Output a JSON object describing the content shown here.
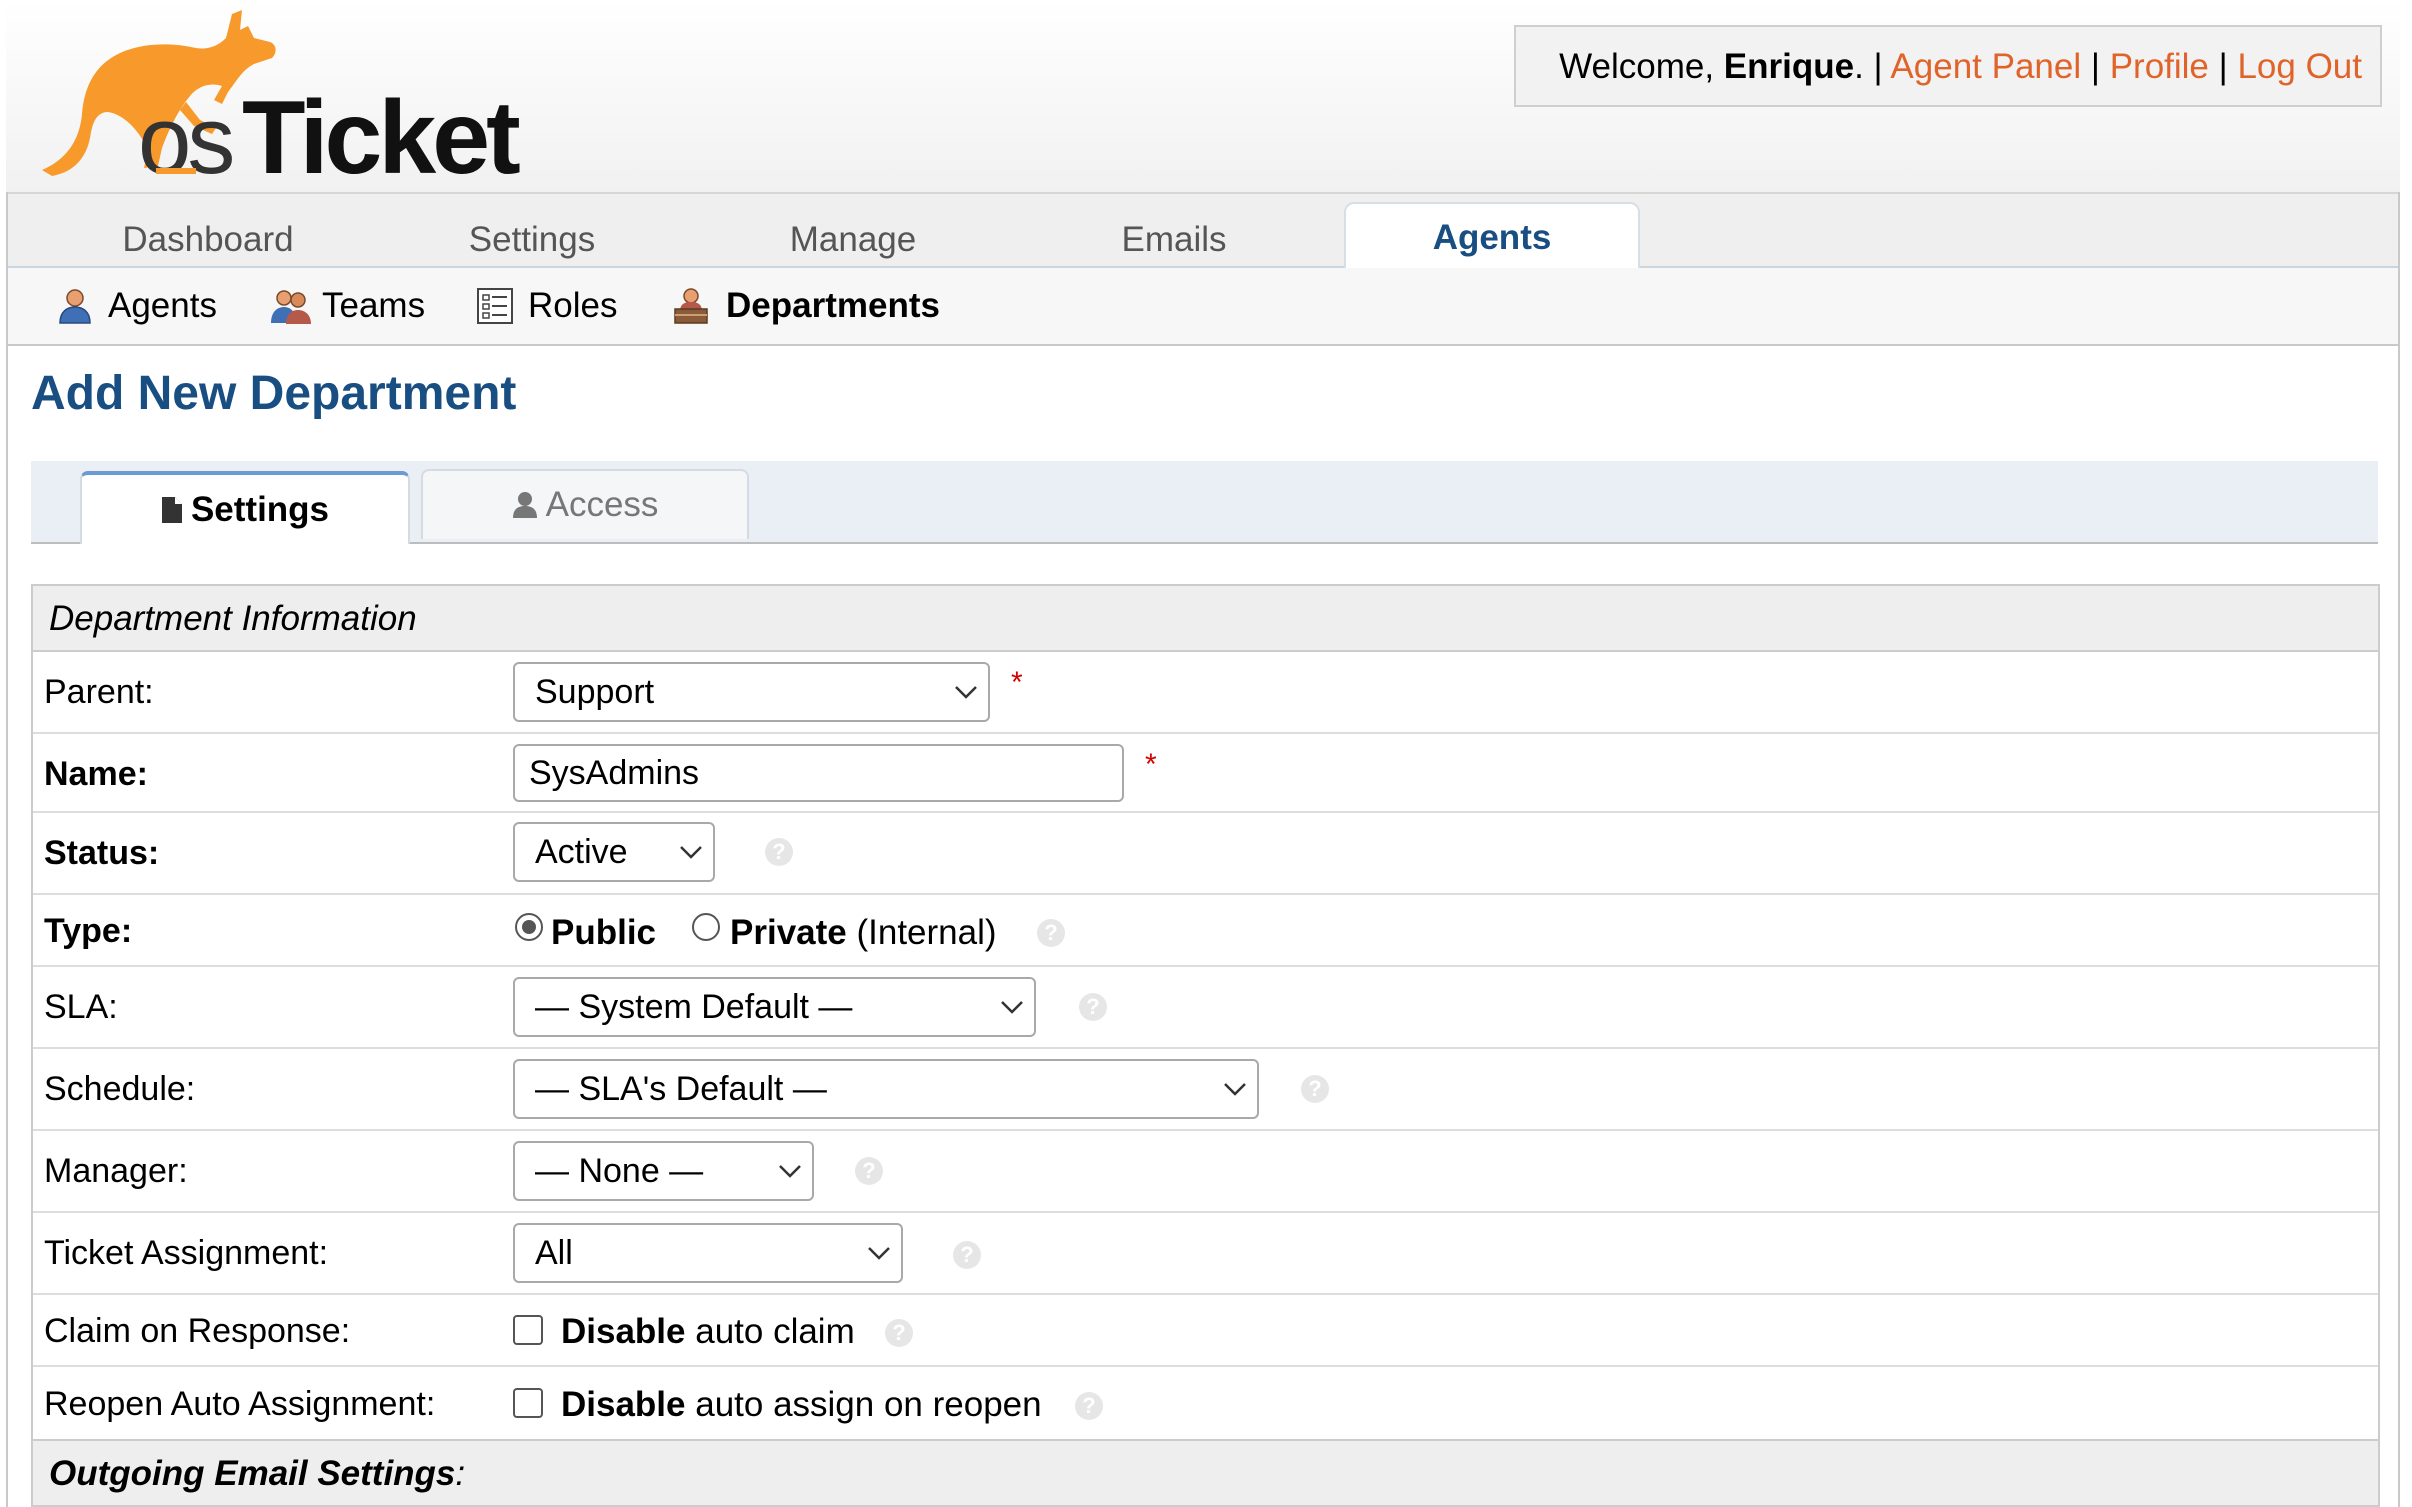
{
  "header": {
    "welcome_prefix": "Welcome, ",
    "user_name": "Enrique",
    "welcome_suffix": ". | ",
    "links": [
      "Agent Panel",
      "Profile",
      "Log Out"
    ],
    "separator": " | "
  },
  "top_nav": {
    "tabs": [
      "Dashboard",
      "Settings",
      "Manage",
      "Emails",
      "Agents"
    ],
    "active": "Agents"
  },
  "sub_nav": {
    "items": [
      "Agents",
      "Teams",
      "Roles",
      "Departments"
    ],
    "active": "Departments"
  },
  "page": {
    "title": "Add New Department"
  },
  "form_tabs": {
    "settings": "Settings",
    "access": "Access",
    "active": "Settings"
  },
  "form": {
    "section_title": "Department Information",
    "parent": {
      "label": "Parent:",
      "value": "Support",
      "required": "*"
    },
    "name": {
      "label": "Name:",
      "value": "SysAdmins",
      "required": "*"
    },
    "status": {
      "label": "Status:",
      "value": "Active"
    },
    "type": {
      "label": "Type:",
      "public": "Public",
      "private": "Private",
      "private_note": " (Internal)",
      "selected": "Public"
    },
    "sla": {
      "label": "SLA:",
      "value": "— System Default —"
    },
    "schedule": {
      "label": "Schedule:",
      "value": "— SLA's Default —"
    },
    "manager": {
      "label": "Manager:",
      "value": "— None —"
    },
    "ticket_assignment": {
      "label": "Ticket Assignment:",
      "value": "All"
    },
    "claim_on_response": {
      "label": "Claim on Response:",
      "bold": "Disable",
      "text": " auto claim",
      "checked": false
    },
    "reopen_auto_assignment": {
      "label": "Reopen Auto Assignment:",
      "bold": "Disable",
      "text": " auto assign on reopen",
      "checked": false
    },
    "help_glyph": "?",
    "next_section_title": "Outgoing Email Settings",
    "next_section_suffix": ":"
  },
  "colors": {
    "brand_orange": "#f79a2b",
    "link_orange": "#e0642a",
    "title_blue": "#184e81",
    "required_red": "#d40000"
  },
  "icons": [
    "osticket-logo",
    "agent-icon",
    "teams-icon",
    "roles-icon",
    "departments-icon",
    "file-icon",
    "user-icon",
    "chevron-down-icon",
    "help-icon"
  ]
}
